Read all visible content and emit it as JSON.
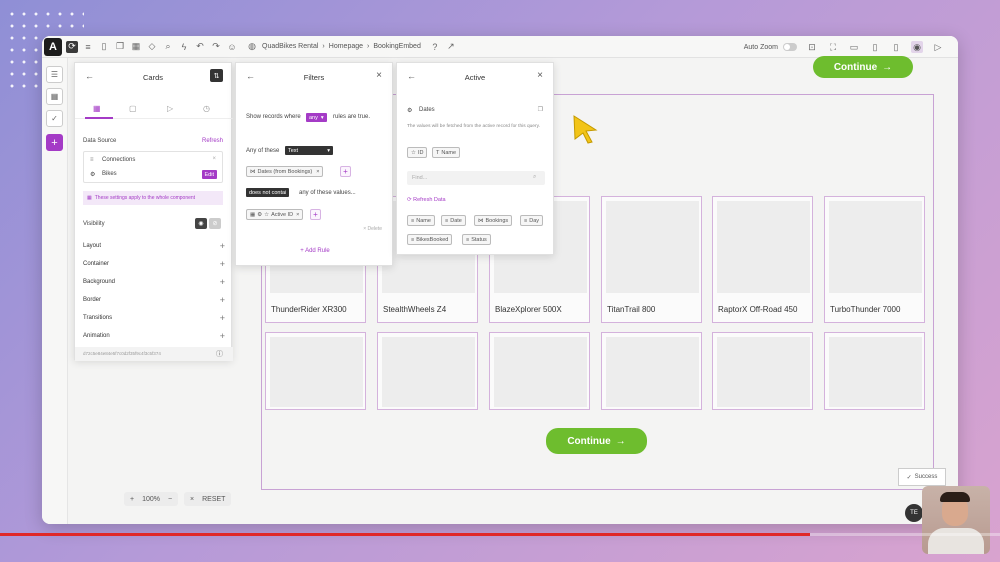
{
  "toolbar": {
    "breadcrumb": [
      "QuadBikes Rental",
      "Homepage",
      "BookingEmbed"
    ],
    "auto_zoom_label": "Auto Zoom"
  },
  "cards_panel": {
    "title": "Cards",
    "data_source_label": "Data Source",
    "refresh_label": "Refresh",
    "connections_label": "Connections",
    "bikes_label": "Bikes",
    "edit_label": "Edit",
    "note": "These settings apply to the whole component",
    "visibility_label": "Visibility",
    "sections": [
      "Layout",
      "Container",
      "Background",
      "Border",
      "Transitions",
      "Animation"
    ],
    "component_id": "d72c5e84e84e5f7c0d2f35f9c4f3c5f374"
  },
  "filters_panel": {
    "title": "Filters",
    "show_records_prefix": "Show records where",
    "any_value": "any",
    "show_records_suffix": "rules are true.",
    "any_of_these": "Any of these",
    "text_value": "Text",
    "dates_chip": "Dates (from Bookings)",
    "does_not_contain": "does not contai",
    "any_of_values": "any of these values...",
    "active_id_chip": "Active ID",
    "delete_label": "× Delete",
    "add_rule": "+ Add Rule"
  },
  "active_panel": {
    "title": "Active",
    "dates_label": "Dates",
    "description": "The values will be fetched from the active record for this query.",
    "fields_top": [
      "ID",
      "Name"
    ],
    "find_placeholder": "Find...",
    "refresh_data": "Refresh Data",
    "fields": [
      "Name",
      "Date",
      "Bookings",
      "Day",
      "BikesBooked",
      "Status"
    ]
  },
  "canvas": {
    "continue_label": "Continue",
    "cards_row1": [
      "ThunderRider XR300",
      "StealthWheels Z4",
      "BlazeXplorer 500X",
      "TitanTrail 800",
      "RaptorX Off-Road 450",
      "TurboThunder 7000"
    ],
    "zoom_level": "100%",
    "reset_label": "RESET",
    "success_label": "Success",
    "avatar_initials": "TE"
  },
  "video": {
    "progress": 0.81
  },
  "colors": {
    "accent_purple": "#a43bc6",
    "continue_green": "#6ebd2e",
    "progress_red": "#e02828"
  }
}
